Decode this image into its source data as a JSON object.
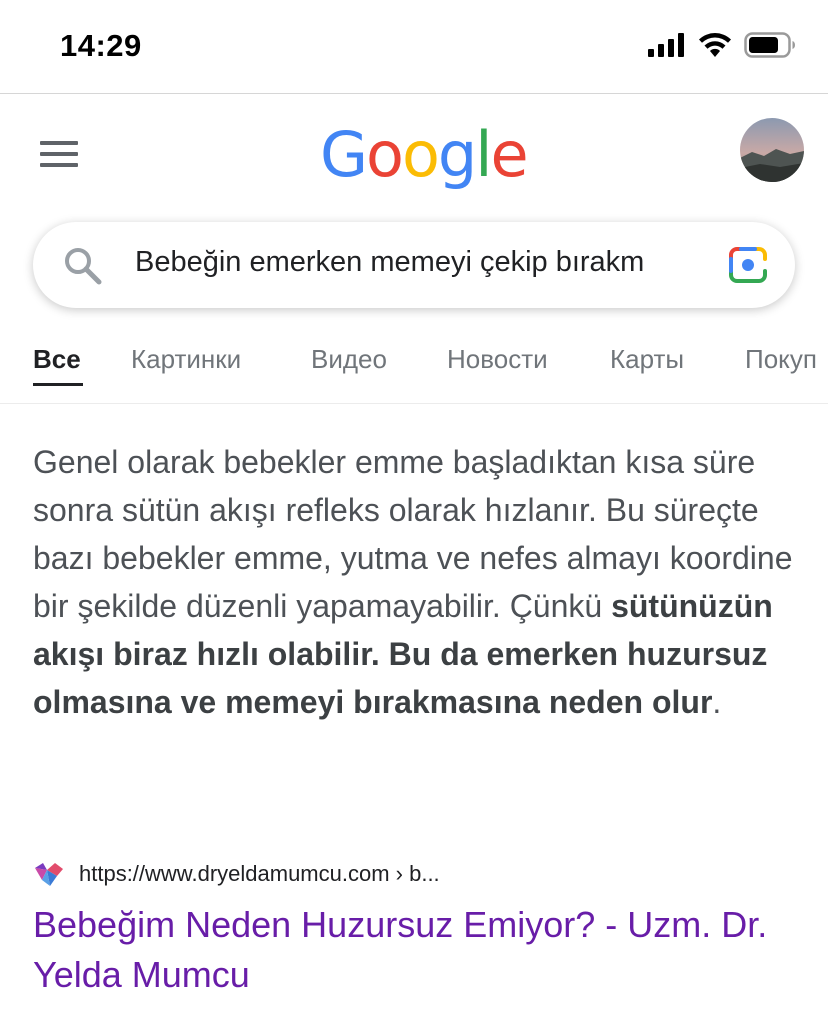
{
  "status_bar": {
    "time": "14:29"
  },
  "header": {
    "logo_letters": [
      {
        "char": "G",
        "color": "#4285F4"
      },
      {
        "char": "o",
        "color": "#EA4335"
      },
      {
        "char": "o",
        "color": "#FBBC05"
      },
      {
        "char": "g",
        "color": "#4285F4"
      },
      {
        "char": "l",
        "color": "#34A853"
      },
      {
        "char": "e",
        "color": "#EA4335"
      }
    ],
    "menu_icon": "hamburger-icon",
    "avatar": "profile-avatar"
  },
  "search": {
    "query": "Bebeğin emerken memeyi çekip bırakm",
    "left_icon": "search-icon",
    "right_icon": "google-lens-icon"
  },
  "tabs": [
    {
      "label": "Все",
      "active": true
    },
    {
      "label": "Картинки",
      "active": false
    },
    {
      "label": "Видео",
      "active": false
    },
    {
      "label": "Новости",
      "active": false
    },
    {
      "label": "Карты",
      "active": false
    },
    {
      "label": "Покуп",
      "active": false
    }
  ],
  "snippet": {
    "normal_text": "Genel olarak bebekler emme başladıktan kısa süre sonra sütün akışı refleks olarak hızlanır. Bu süreçte bazı bebekler emme, yutma ve nefes almayı koordine bir şekilde düzenli yapamayabilir. Çünkü ",
    "bold_text": "sütünüzün akışı biraz hızlı olabilir. Bu da emerken huzursuz olmasına ve memeyi bırakmasına neden olur",
    "end_text": "."
  },
  "result": {
    "url": "https://www.dryeldamumcu.com › b...",
    "title": "Bebeğim Neden Huzursuz Emiyor? - Uzm. Dr. Yelda Mumcu",
    "title_color": "#681da8"
  }
}
